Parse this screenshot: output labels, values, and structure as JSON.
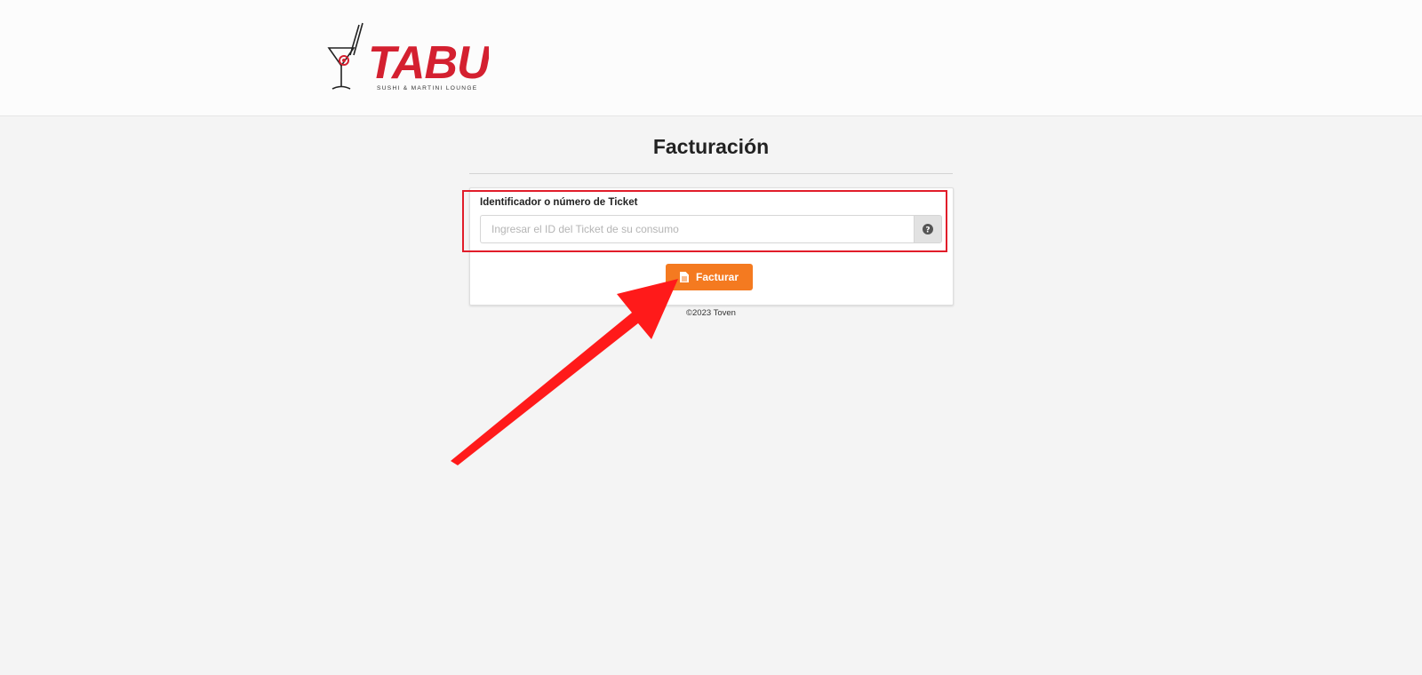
{
  "brand": {
    "logo_text": "TABU",
    "logo_subtitle": "SUSHI & MARTINI LOUNGE",
    "logo_color": "#d42030"
  },
  "page": {
    "title": "Facturación"
  },
  "form": {
    "ticket_label": "Identificador o número de Ticket",
    "ticket_value": "",
    "ticket_placeholder": "Ingresar el ID del Ticket de su consumo",
    "help_icon": "question-circle-icon",
    "submit_label": "Facturar",
    "submit_icon": "document-icon",
    "submit_color": "#f47a20"
  },
  "annotation": {
    "highlight_color": "#e11d2a",
    "arrow_color": "#ff1a1a"
  },
  "footer": {
    "copyright": "©2023 Toven"
  }
}
